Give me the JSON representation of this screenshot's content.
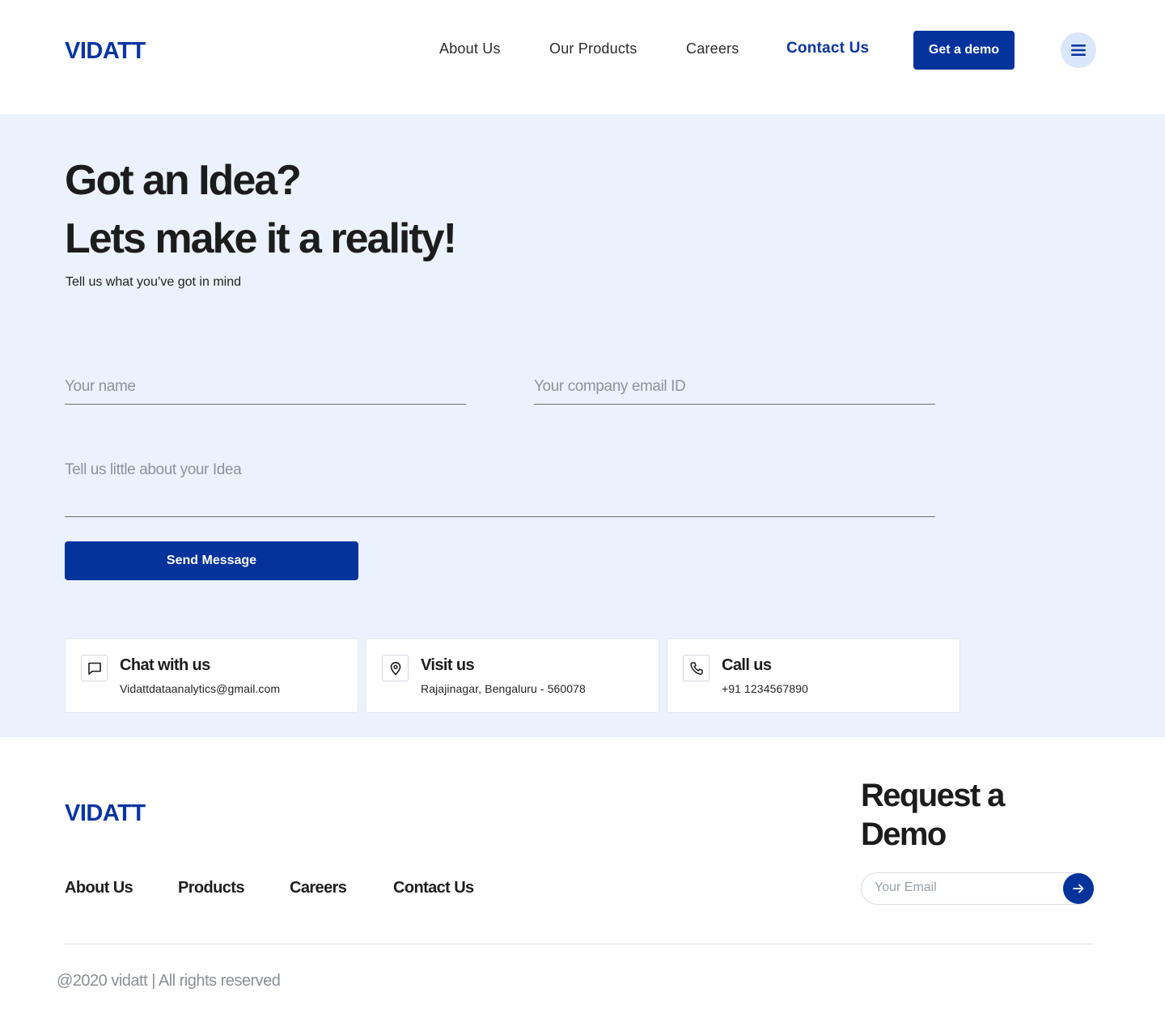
{
  "brand": {
    "name": "VIDATT",
    "color": "#0a35a0"
  },
  "header": {
    "nav": [
      {
        "label": "About Us"
      },
      {
        "label": "Our Products"
      },
      {
        "label": "Careers"
      },
      {
        "label": "Contact Us",
        "active": true
      }
    ],
    "demo_button": "Get a demo",
    "menu_icon": "hamburger-icon"
  },
  "hero": {
    "title_line1": "Got an Idea?",
    "title_line2": "Lets make it a reality!",
    "subtitle": "Tell us what you’ve got in mind",
    "form": {
      "name_placeholder": "Your name",
      "email_placeholder": "Your company email ID",
      "idea_placeholder": "Tell us little about your Idea",
      "submit_label": "Send Message"
    },
    "contacts": [
      {
        "icon": "chat-icon",
        "title": "Chat with us",
        "value": "Vidattdataanalytics@gmail.com"
      },
      {
        "icon": "location-pin-icon",
        "title": "Visit us",
        "value": "Rajajinagar, Bengaluru - 560078"
      },
      {
        "icon": "phone-icon",
        "title": "Call us",
        "value": "+91 1234567890"
      }
    ]
  },
  "footer": {
    "nav": [
      {
        "label": "About Us"
      },
      {
        "label": "Products"
      },
      {
        "label": "Careers"
      },
      {
        "label": "Contact Us"
      }
    ],
    "request_title": "Request a Demo",
    "email_placeholder": "Your Email",
    "submit_icon": "arrow-right-icon",
    "copyright": "@2020 vidatt | All rights reserved"
  },
  "colors": {
    "primary": "#03339b",
    "hero_bg": "#ebf2fd",
    "menu_bg": "#d9e6fb"
  }
}
